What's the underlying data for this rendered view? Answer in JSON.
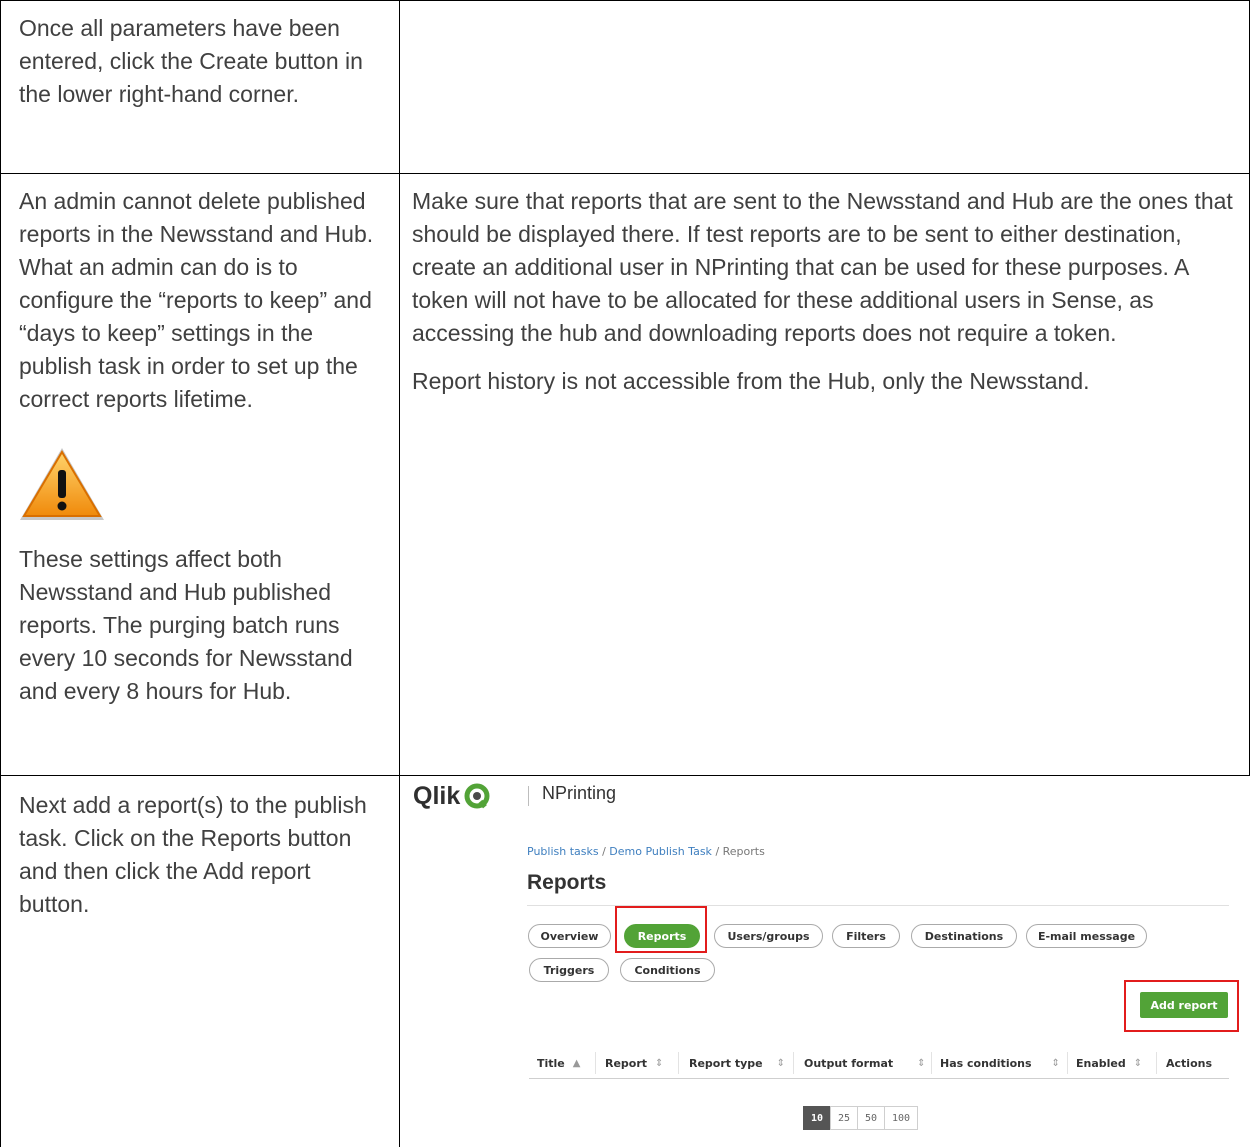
{
  "row1": {
    "left_text": "Once all parameters have been entered, click the Create button in the lower right-hand corner."
  },
  "row2": {
    "warning_icon": "warning-triangle-icon",
    "left_paragraphs": [
      "An admin cannot delete published reports in the Newsstand and Hub. What an admin can do is to configure the “reports to keep” and “days to keep” settings in the publish task in order to set up the correct reports lifetime.",
      "These settings affect both Newsstand and Hub published reports. The purging batch runs every 10 seconds for Newsstand and every 8 hours for Hub."
    ],
    "right_paragraphs": [
      "Make sure that reports that are sent to the Newsstand and Hub are the ones that should be displayed there. If test reports are to be sent to either destination, create an additional user in NPrinting that can be used for these purposes. A token will not have to be allocated for these additional users in Sense, as accessing the hub and downloading reports does not require a token.",
      "Report history is not accessible from the Hub, only the Newsstand."
    ]
  },
  "row3": {
    "left_text": "Next add a report(s) to the publish task. Click on the Reports button and then click the Add report button."
  },
  "screenshot": {
    "brand": "Qlik",
    "product": "NPrinting",
    "breadcrumb": [
      "Publish tasks",
      "Demo Publish Task",
      "Reports"
    ],
    "page_title": "Reports",
    "tabs": [
      "Overview",
      "Reports",
      "Users/groups",
      "Filters",
      "Destinations",
      "E-mail message",
      "Triggers",
      "Conditions"
    ],
    "active_tab": "Reports",
    "add_button": "Add report",
    "columns": [
      "Title",
      "Report",
      "Report type",
      "Output format",
      "Has conditions",
      "Enabled",
      "Actions"
    ],
    "page_sizes": [
      "10",
      "25",
      "50",
      "100"
    ],
    "active_page_size": "10",
    "accent_color": "#52a337",
    "highlight_color": "#e21c1c"
  }
}
